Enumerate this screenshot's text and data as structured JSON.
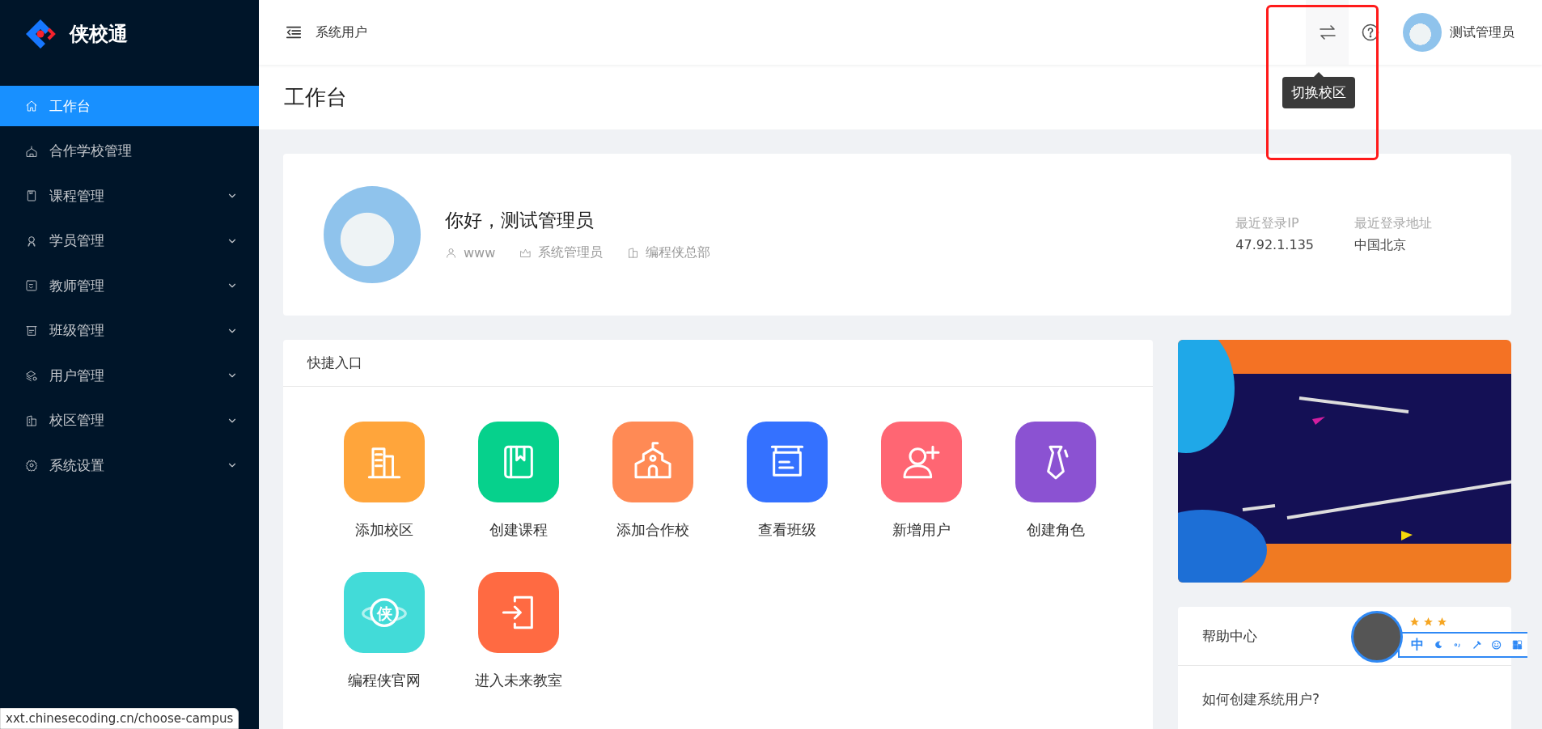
{
  "sidebar": {
    "logo_text": "侠校通",
    "items": [
      {
        "label": "工作台",
        "kind": "home",
        "selected": true,
        "has_submenu": false
      },
      {
        "label": "合作学校管理",
        "kind": "school",
        "selected": false,
        "has_submenu": false
      },
      {
        "label": "课程管理",
        "kind": "book",
        "selected": false,
        "has_submenu": true
      },
      {
        "label": "学员管理",
        "kind": "student",
        "selected": false,
        "has_submenu": true
      },
      {
        "label": "教师管理",
        "kind": "teacher",
        "selected": false,
        "has_submenu": true
      },
      {
        "label": "班级管理",
        "kind": "board",
        "selected": false,
        "has_submenu": true
      },
      {
        "label": "用户管理",
        "kind": "users",
        "selected": false,
        "has_submenu": true
      },
      {
        "label": "校区管理",
        "kind": "campus",
        "selected": false,
        "has_submenu": true
      },
      {
        "label": "系统设置",
        "kind": "gear",
        "selected": false,
        "has_submenu": true
      }
    ]
  },
  "header": {
    "breadcrumb": "系统用户",
    "user_name": "测试管理员",
    "tooltip": "切换校区"
  },
  "page_title": "工作台",
  "profile": {
    "greeting": "你好，测试管理员",
    "meta": [
      {
        "kind": "user",
        "text": "www"
      },
      {
        "kind": "crown",
        "text": "系统管理员"
      },
      {
        "kind": "building",
        "text": "编程侠总部"
      }
    ],
    "stats": [
      {
        "label": "最近登录IP",
        "value": "47.92.1.135"
      },
      {
        "label": "最近登录地址",
        "value": "中国北京"
      }
    ]
  },
  "quick_entry": {
    "title": "快捷入口",
    "items": [
      {
        "label": "添加校区",
        "kind": "building",
        "color": "#ffa53b"
      },
      {
        "label": "创建课程",
        "kind": "book",
        "color": "#06d18c"
      },
      {
        "label": "添加合作校",
        "kind": "school",
        "color": "#ff8a55"
      },
      {
        "label": "查看班级",
        "kind": "board",
        "color": "#3471ff"
      },
      {
        "label": "新增用户",
        "kind": "adduser",
        "color": "#ff6673"
      },
      {
        "label": "创建角色",
        "kind": "tie",
        "color": "#8b52d2"
      },
      {
        "label": "编程侠官网",
        "kind": "planet",
        "glyph": "侠",
        "color": "#42dbd8"
      },
      {
        "label": "进入未来教室",
        "kind": "enter",
        "color": "#ff6a42"
      }
    ]
  },
  "help_center": {
    "title": "帮助中心",
    "items": [
      "如何创建系统用户?"
    ]
  },
  "ime_toolbar": {
    "mode": "中",
    "stars": 3
  },
  "status_url": "xxt.chinesecoding.cn/choose-campus"
}
